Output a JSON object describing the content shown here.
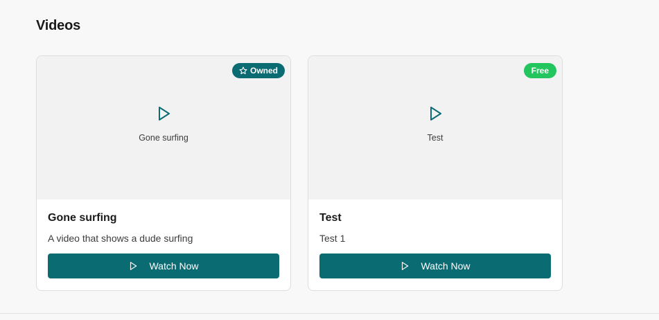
{
  "section": {
    "title": "Videos"
  },
  "videos": [
    {
      "thumb_title": "Gone surfing",
      "badge": {
        "label": "Owned",
        "icon": "star-icon",
        "color": "#0b6b73"
      },
      "title": "Gone surfing",
      "description": "A video that shows a dude surfing",
      "button_label": "Watch Now"
    },
    {
      "thumb_title": "Test",
      "badge": {
        "label": "Free",
        "color": "#22c55e"
      },
      "title": "Test",
      "description": "Test 1",
      "button_label": "Watch Now"
    }
  ],
  "colors": {
    "accent": "#0b6b73",
    "free": "#22c55e",
    "background": "#f8f8f8"
  }
}
